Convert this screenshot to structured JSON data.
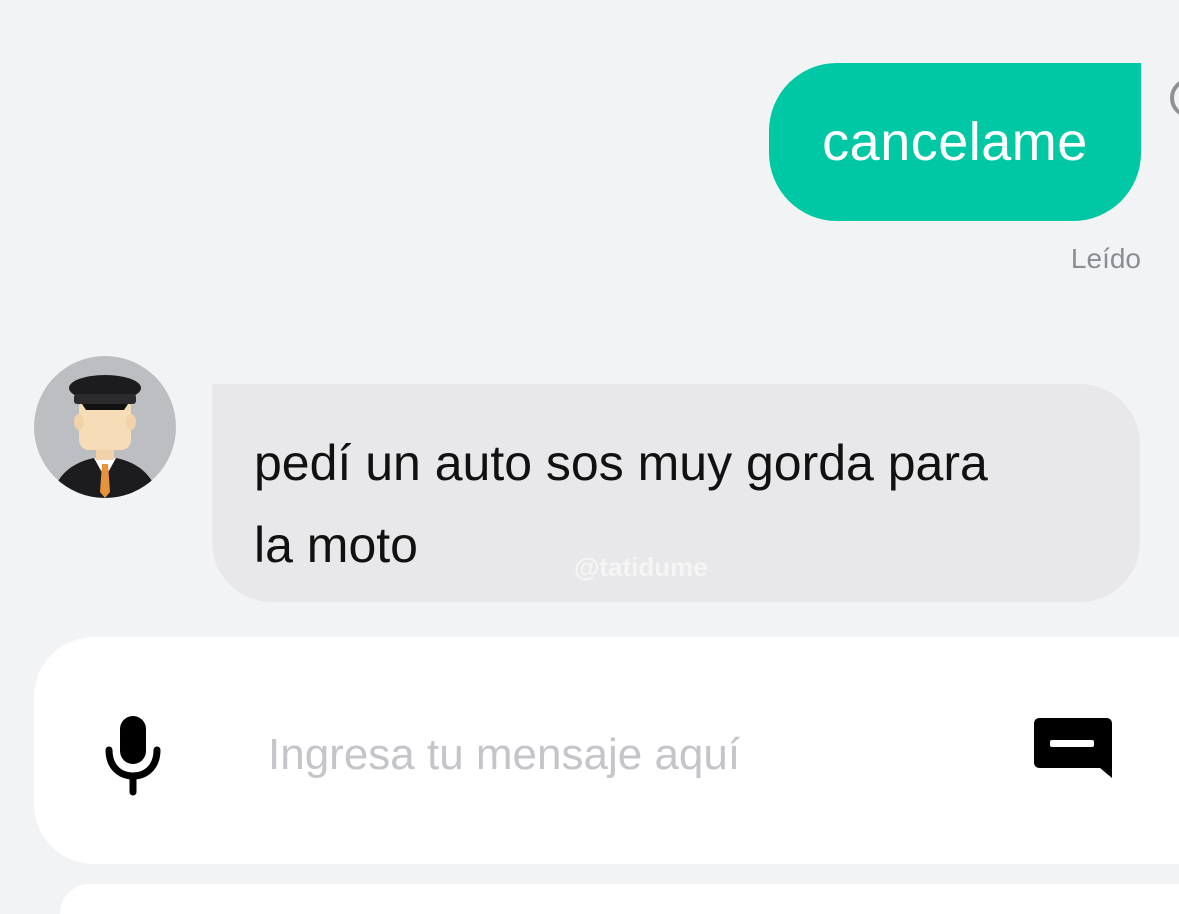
{
  "chat": {
    "sent_message": {
      "text": "cancelame",
      "status": "Leído"
    },
    "received_message": {
      "text": "pedí un auto sos muy gorda para la moto"
    },
    "watermark": "@tatidume"
  },
  "composer": {
    "placeholder": "Ingresa tu mensaje aquí",
    "value": ""
  },
  "colors": {
    "sent_bubble": "#00c8a4",
    "received_bubble": "#e8e8ea",
    "background": "#f2f3f5",
    "placeholder": "#c4c5c9"
  },
  "icons": {
    "mic": "microphone-icon",
    "quick_reply": "quick-message-icon",
    "driver": "driver-avatar-icon"
  }
}
